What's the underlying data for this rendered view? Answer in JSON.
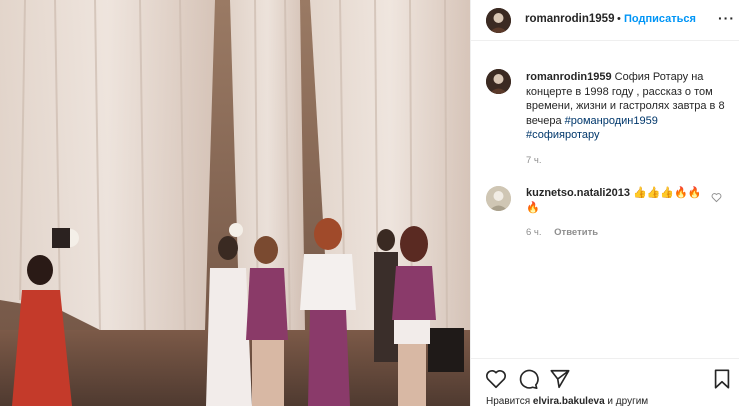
{
  "post": {
    "author": "romanrodin1959",
    "separator": "•",
    "follow_label": "Подписаться",
    "more_label": "···"
  },
  "caption": {
    "username": "romanrodin1959",
    "text": "София Ротару на концерте в 1998 году , рассказ о том времени, жизни и гастролях завтра в 8 вечера",
    "hashtags": [
      "#романродин1959",
      "#софияротару"
    ],
    "time": "7 ч."
  },
  "comment": {
    "username": "kuznetso.natali2013",
    "text": "👍👍👍🔥🔥🔥",
    "time": "6 ч.",
    "reply_label": "Ответить"
  },
  "actions": {
    "icons": [
      "heart-icon",
      "comment-icon",
      "share-icon",
      "bookmark-icon"
    ]
  },
  "likes": {
    "prefix": "Нравится",
    "user": "elvira.bakuleva",
    "suffix": "и другим"
  },
  "colors": {
    "follow": "#0095f6",
    "hashtag": "#00376b",
    "muted": "#8e8e8e",
    "border": "#efefef"
  }
}
